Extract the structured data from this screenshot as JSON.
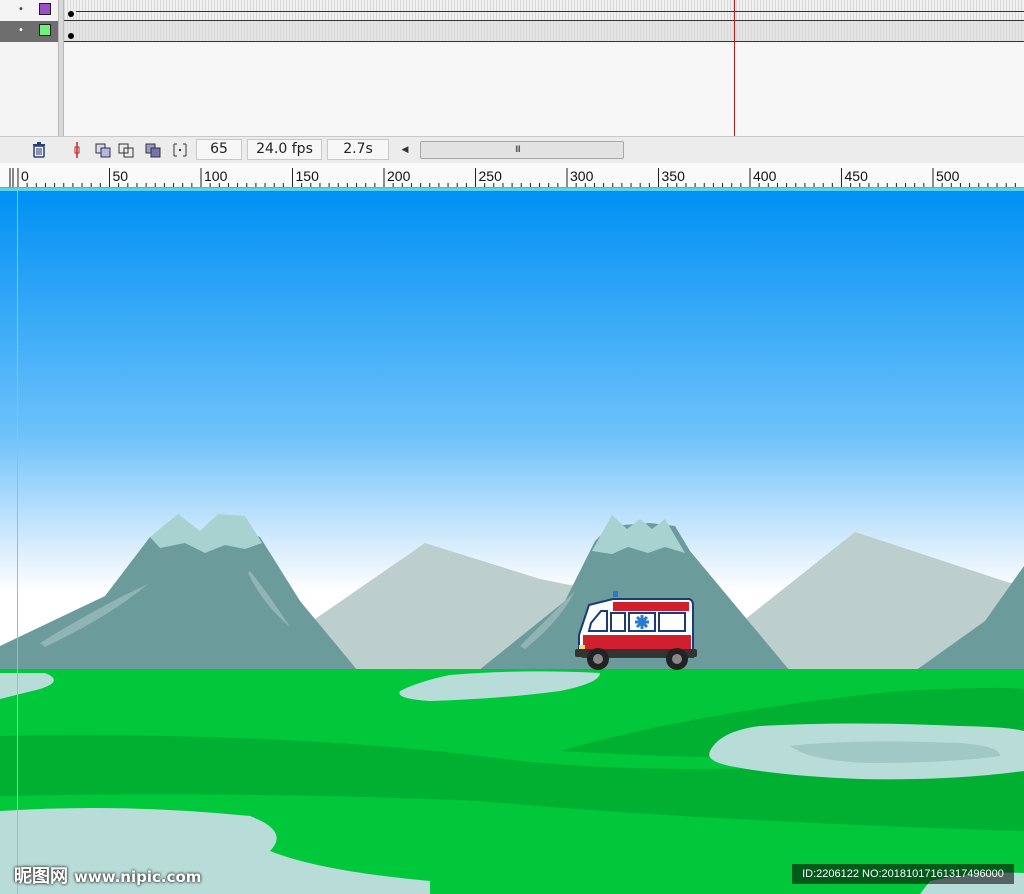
{
  "timeline": {
    "layers": [
      {
        "visibility_glyph": "•",
        "swatch_color": "#9c4dcc",
        "selected": false
      },
      {
        "visibility_glyph": "•",
        "swatch_color": "#6df27a",
        "selected": true
      }
    ],
    "toolbar": {
      "delete_icon": "trash-icon",
      "current_frame": "65",
      "frame_rate": "24.0 fps",
      "elapsed_time": "2.7s",
      "scroll_left_glyph": "◀",
      "scroll_thumb_grip": "III"
    }
  },
  "ruler": {
    "labels": [
      "0",
      "50",
      "100",
      "150",
      "200",
      "250",
      "300",
      "350",
      "400",
      "450",
      "500"
    ]
  },
  "stage": {
    "vehicle": "ambulance",
    "colors": {
      "sky_top": "#0090f4",
      "sky_bottom": "#ffffff",
      "mountain_far": "#bccfcd",
      "mountain_near": "#6b9b9a",
      "snow": "#a8d2d0",
      "grass_light": "#00c83a",
      "grass_dark": "#00b030",
      "water": "#b8dcd8",
      "ambulance_red": "#d0202e"
    }
  },
  "watermark": {
    "site_name": "昵图网",
    "site_url": "www.nipic.com",
    "image_id": "ID:2206122 NO:20181017161317496000"
  }
}
